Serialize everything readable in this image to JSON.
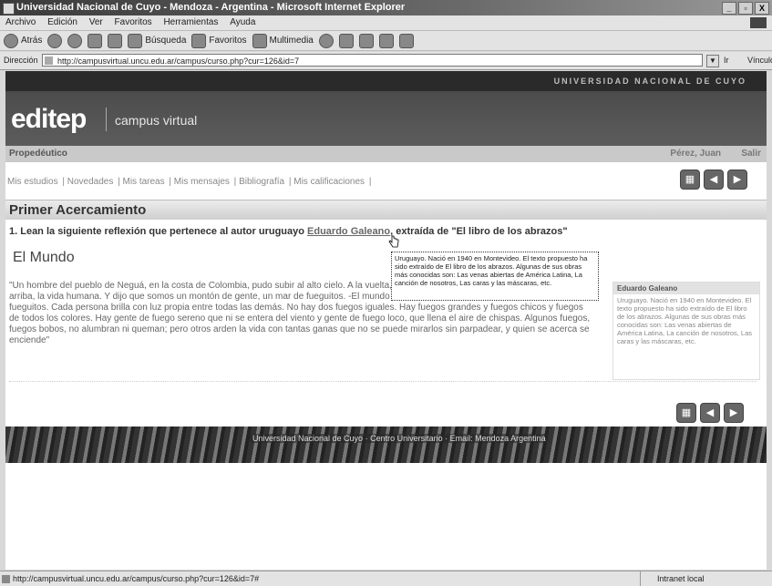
{
  "window": {
    "title": "Universidad Nacional de Cuyo - Mendoza - Argentina - Microsoft Internet Explorer",
    "controls": [
      "_",
      "▫",
      "X"
    ]
  },
  "menu": [
    "Archivo",
    "Edición",
    "Ver",
    "Favoritos",
    "Herramientas",
    "Ayuda"
  ],
  "toolbar": {
    "back": "Atrás",
    "search": "Búsqueda",
    "favorites": "Favoritos",
    "multimedia": "Multimedia"
  },
  "address": {
    "label": "Dirección",
    "url": "http://campusvirtual.uncu.edu.ar/campus/curso.php?cur=126&id=7",
    "go": "Ir",
    "links": "Vínculos"
  },
  "site": {
    "university": "UNIVERSIDAD NACIONAL DE CUYO",
    "brand": "editep",
    "brand_sub": "campus virtual",
    "course": "Propedéutico",
    "user": "Pérez, Juan",
    "logout": "Salir",
    "nav": [
      "Mis estudios",
      "Novedades",
      "Mis tareas",
      "Mis mensajes",
      "Bibliografía",
      "Mis calificaciones"
    ],
    "section_title": "Primer Acercamiento",
    "instruction_pre": "1. Lean la siguiente reflexión que pertenece al autor uruguayo ",
    "instruction_link": "Eduardo Galeano",
    "instruction_post": ", extraída de \"El libro de los abrazos\"",
    "heading": "El Mundo",
    "quote": "\"Un hombre del pueblo de Neguá, en la costa de Colombia, pudo subir al alto cielo. A la vuelta, contó. Dijo que había contemplado desde allá arriba, la vida humana. Y dijo que somos un montón de gente, un mar de fueguitos. -El mundo es eso -reveló-. Un montón de gente, un mar de fueguitos. Cada persona brilla con luz propia entre todas las demás. No hay dos fuegos iguales. Hay fuegos grandes y fuegos chicos y fuegos de todos los colores. Hay gente de fuego sereno que ni se entera del viento y gente de fuego loco, que llena el aire de chispas. Algunos fuegos, fuegos bobos, no alumbran ni queman; pero otros arden la vida con tantas ganas que no se puede mirarlos sin parpadear, y quien se acerca se enciende\"",
    "tooltip": "Uruguayo. Nació en 1940 en Montevideo. El texto propuesto ha sido extraído de El libro de los abrazos. Algunas de sus obras más conocidas son: Las venas abiertas de América Latina, La canción de nosotros, Las caras y las máscaras, etc.",
    "sidebox_title": "Eduardo Galeano",
    "sidebox_text": "Uruguayo. Nació en 1940 en Montevideo. El texto propuesto ha sido extraído de El libro de los abrazos. Algunas de sus obras más conocidas son: Las venas abiertas de América Latina, La canción de nosotros, Las caras y las máscaras, etc.",
    "footer": "Universidad Nacional de Cuyo · Centro Universitario · Email: Mendoza Argentina"
  },
  "status": {
    "url": "http://campusvirtual.uncu.edu.ar/campus/curso.php?cur=126&id=7#",
    "zone": "Intranet local"
  }
}
